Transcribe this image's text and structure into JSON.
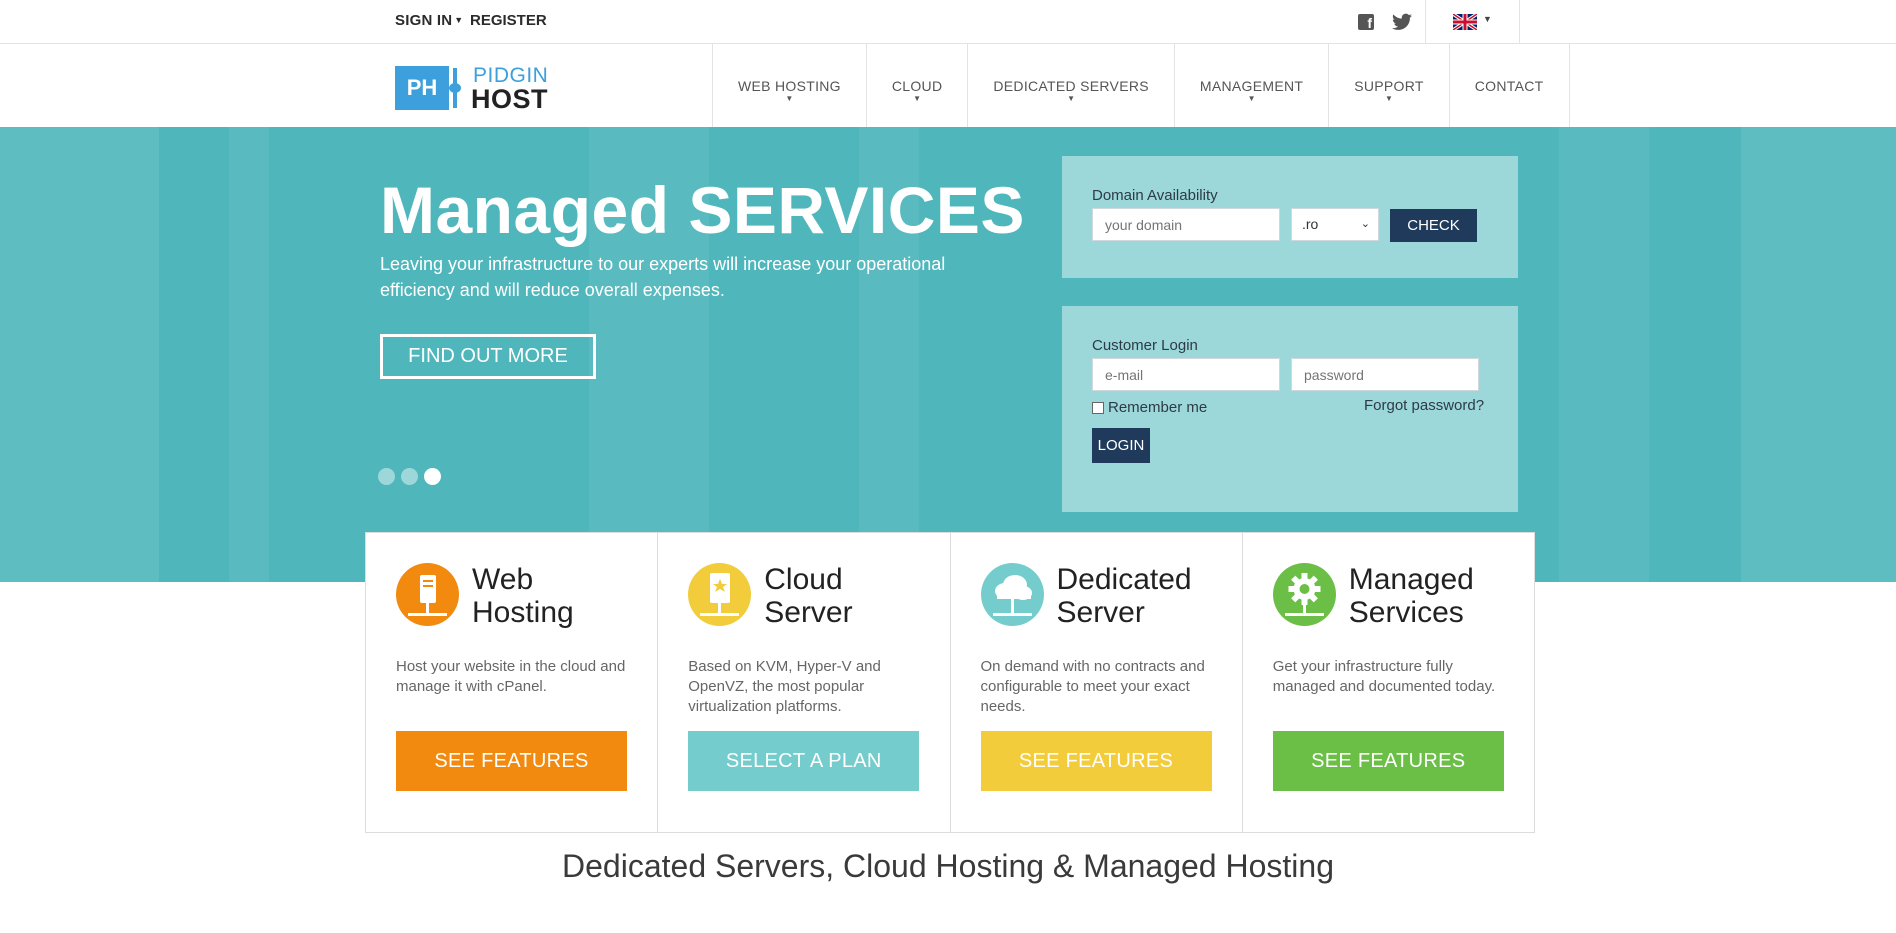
{
  "topbar": {
    "sign_in": "SIGN IN",
    "register": "REGISTER",
    "facebook_icon": "facebook-icon",
    "twitter_icon": "twitter-icon",
    "language_icon": "uk-flag-icon"
  },
  "logo": {
    "initials": "PH",
    "line1": "PIDGIN",
    "line2": "HOST"
  },
  "nav": {
    "items": [
      {
        "label": "WEB HOSTING",
        "dropdown": true
      },
      {
        "label": "CLOUD",
        "dropdown": true
      },
      {
        "label": "DEDICATED SERVERS",
        "dropdown": true
      },
      {
        "label": "MANAGEMENT",
        "dropdown": true
      },
      {
        "label": "SUPPORT",
        "dropdown": true
      },
      {
        "label": "CONTACT",
        "dropdown": false
      }
    ]
  },
  "hero": {
    "title": "Managed SERVICES",
    "subtitle": "Leaving your infrastructure to our experts will increase your operational efficiency and will reduce overall expenses.",
    "cta": "FIND OUT MORE",
    "slides_total": 3,
    "active_slide": 3
  },
  "domain": {
    "title": "Domain Availability",
    "placeholder": "your domain",
    "tld": ".ro",
    "check": "CHECK"
  },
  "login": {
    "title": "Customer Login",
    "email_placeholder": "e-mail",
    "password_placeholder": "password",
    "remember": "Remember me",
    "forgot": "Forgot password?",
    "button": "LOGIN"
  },
  "cards": [
    {
      "title_l1": "Web",
      "title_l2": "Hosting",
      "desc": "Host your website in the cloud and manage it with cPanel.",
      "cta": "SEE FEATURES",
      "color": "#f18a0e",
      "icon": "server-tower-icon"
    },
    {
      "title_l1": "Cloud",
      "title_l2": "Server",
      "desc": "Based on KVM, Hyper-V and OpenVZ, the most popular virtualization platforms.",
      "cta": "SELECT A PLAN",
      "color": "#75cccd",
      "icon": "cloud-server-icon"
    },
    {
      "title_l1": "Dedicated",
      "title_l2": "Server",
      "desc": "On demand with no contracts and configurable to meet your exact needs.",
      "cta": "SEE FEATURES",
      "color": "#f3cc3b",
      "icon": "cloud-icon"
    },
    {
      "title_l1": "Managed",
      "title_l2": "Services",
      "desc": "Get your infrastructure fully managed and documented today.",
      "cta": "SEE FEATURES",
      "color": "#6bbf47",
      "icon": "gear-icon"
    }
  ],
  "bottom_heading": "Dedicated Servers, Cloud Hosting & Managed Hosting"
}
